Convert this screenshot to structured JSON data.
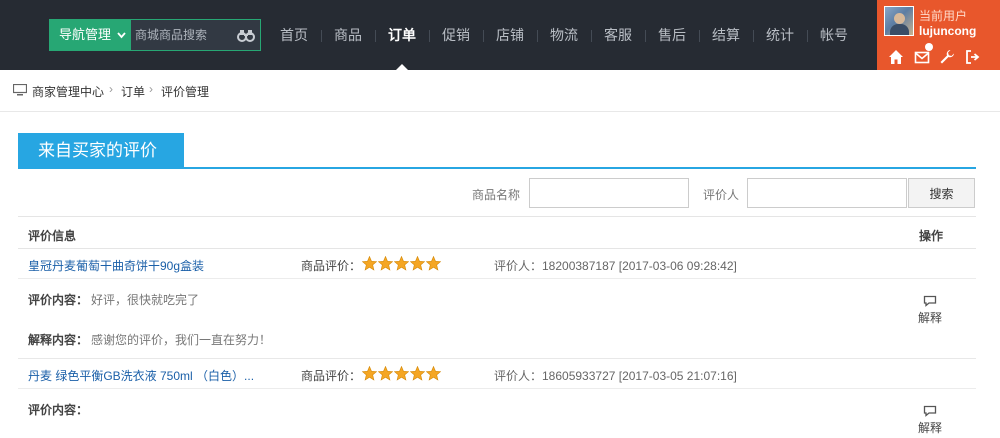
{
  "header": {
    "nav_button_label": "导航管理",
    "search_placeholder": "商城商品搜索",
    "menu": [
      "首页",
      "商品",
      "订单",
      "促销",
      "店铺",
      "物流",
      "客服",
      "售后",
      "结算",
      "统计",
      "帐号"
    ],
    "active_menu": "订单",
    "user": {
      "title": "当前用户",
      "name": "lujuncong"
    },
    "user_icons": [
      "home-icon",
      "mail-icon",
      "wrench-icon",
      "logout-icon"
    ],
    "colors": {
      "topbar": "#262b33",
      "nav_button": "#27a774",
      "user_panel": "#e8572c"
    }
  },
  "breadcrumb": [
    "商家管理中心",
    "订单",
    "评价管理"
  ],
  "page": {
    "tab_title": "来自买家的评价",
    "accent": "#27a6e2",
    "filters": {
      "product_label": "商品名称",
      "product_value": "",
      "reviewer_label": "评价人",
      "reviewer_value": "",
      "search_label": "搜索"
    },
    "table": {
      "col_info": "评价信息",
      "col_action": "操作",
      "rows": [
        {
          "product": "皇冠丹麦葡萄干曲奇饼干90g盒装",
          "rating_label": "商品评价：",
          "stars": 5,
          "reviewer": "评价人：18200387187 [2017-03-06 09:28:42]",
          "content_label": "评价内容：",
          "content": "好评，很快就吃完了",
          "reply_label": "解释内容：",
          "reply": "感谢您的评价，我们一直在努力！",
          "action_label": "解释"
        },
        {
          "product": "丹麦 绿色平衡GB洗衣液 750ml （白色）...",
          "rating_label": "商品评价：",
          "stars": 5,
          "reviewer": "评价人：18605933727 [2017-03-05 21:07:16]",
          "content_label": "评价内容：",
          "content": "",
          "action_label": "解释"
        }
      ]
    }
  }
}
